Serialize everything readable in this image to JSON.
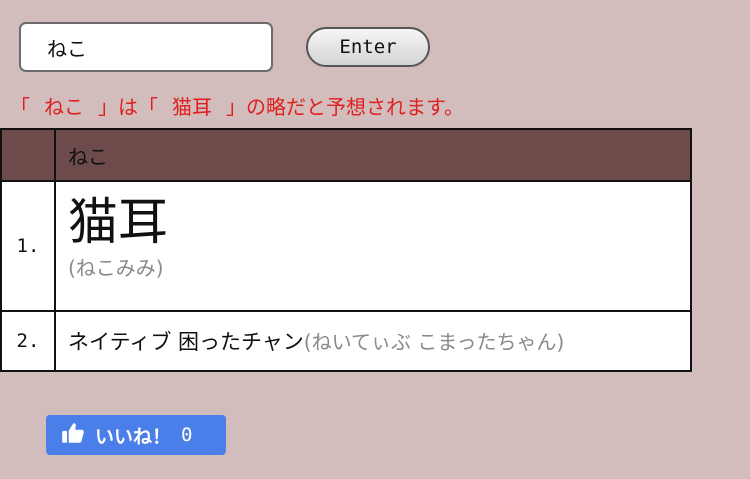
{
  "search": {
    "value": "ねこ",
    "enter_label": "Enter"
  },
  "message": {
    "open1": "「",
    "term": "ねこ",
    "close1": "」は「",
    "guess": "猫耳",
    "close2": "」の略だと予想されます。"
  },
  "table": {
    "header_word": "ねこ",
    "rows": [
      {
        "num": "1.",
        "word": "猫耳",
        "reading": "(ねこみみ)"
      },
      {
        "num": "2.",
        "word": "ネイティブ 困ったチャン",
        "reading": "(ねいてぃぶ こまったちゃん)"
      }
    ]
  },
  "like": {
    "label": "いいね！",
    "count": "0",
    "icon": "thumbs-up-icon"
  }
}
